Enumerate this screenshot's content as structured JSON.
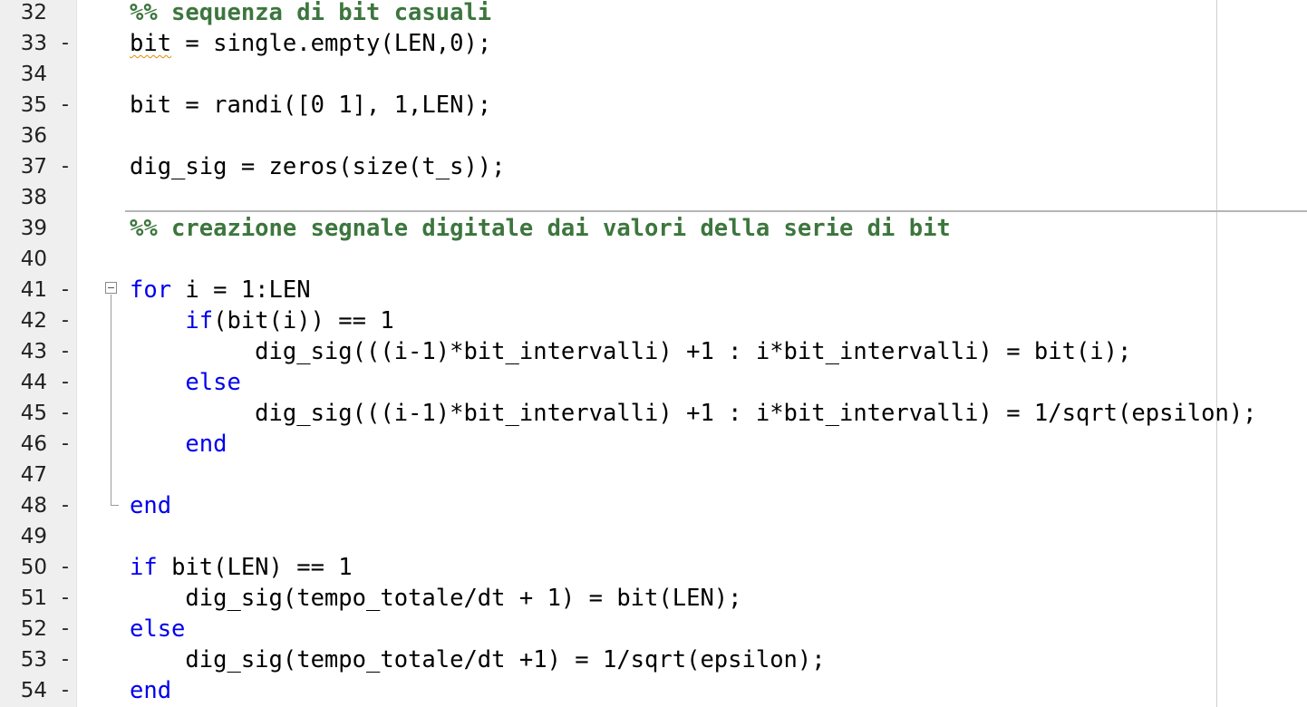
{
  "editor": {
    "lines": [
      {
        "number": "32",
        "marker": "",
        "tokens": [
          {
            "text": "%% sequenza di bit casuali",
            "type": "comment"
          }
        ]
      },
      {
        "number": "33",
        "marker": "-",
        "tokens": [
          {
            "text": "bit",
            "type": "plain",
            "squiggle": true
          },
          {
            "text": " = single.empty(LEN,0);",
            "type": "plain"
          }
        ]
      },
      {
        "number": "34",
        "marker": "",
        "tokens": []
      },
      {
        "number": "35",
        "marker": "-",
        "tokens": [
          {
            "text": "bit = randi([0 1], 1,LEN);",
            "type": "plain"
          }
        ]
      },
      {
        "number": "36",
        "marker": "",
        "tokens": []
      },
      {
        "number": "37",
        "marker": "-",
        "tokens": [
          {
            "text": "dig_sig = zeros(size(t_s));",
            "type": "plain"
          }
        ]
      },
      {
        "number": "38",
        "marker": "",
        "tokens": []
      },
      {
        "number": "39",
        "marker": "",
        "tokens": [
          {
            "text": "%% creazione segnale digitale dai valori della serie di bit",
            "type": "comment"
          }
        ]
      },
      {
        "number": "40",
        "marker": "",
        "tokens": []
      },
      {
        "number": "41",
        "marker": "-",
        "tokens": [
          {
            "text": "for",
            "type": "keyword"
          },
          {
            "text": " i = 1:LEN",
            "type": "plain"
          }
        ]
      },
      {
        "number": "42",
        "marker": "-",
        "tokens": [
          {
            "text": "    ",
            "type": "plain"
          },
          {
            "text": "if",
            "type": "keyword"
          },
          {
            "text": "(bit(i)) == 1",
            "type": "plain"
          }
        ]
      },
      {
        "number": "43",
        "marker": "-",
        "tokens": [
          {
            "text": "         dig_sig(((i-1)*bit_intervalli) +1 : i*bit_intervalli) = bit(i);",
            "type": "plain"
          }
        ]
      },
      {
        "number": "44",
        "marker": "-",
        "tokens": [
          {
            "text": "    ",
            "type": "plain"
          },
          {
            "text": "else",
            "type": "keyword"
          }
        ]
      },
      {
        "number": "45",
        "marker": "-",
        "tokens": [
          {
            "text": "         dig_sig(((i-1)*bit_intervalli) +1 : i*bit_intervalli) = 1/sqrt(epsilon);",
            "type": "plain"
          }
        ]
      },
      {
        "number": "46",
        "marker": "-",
        "tokens": [
          {
            "text": "    ",
            "type": "plain"
          },
          {
            "text": "end",
            "type": "keyword"
          }
        ]
      },
      {
        "number": "47",
        "marker": "",
        "tokens": []
      },
      {
        "number": "48",
        "marker": "-",
        "tokens": [
          {
            "text": "end",
            "type": "keyword"
          }
        ]
      },
      {
        "number": "49",
        "marker": "",
        "tokens": []
      },
      {
        "number": "50",
        "marker": "-",
        "tokens": [
          {
            "text": "if",
            "type": "keyword"
          },
          {
            "text": " bit(LEN) == 1",
            "type": "plain"
          }
        ]
      },
      {
        "number": "51",
        "marker": "-",
        "tokens": [
          {
            "text": "    dig_sig(tempo_totale/dt + 1) = bit(LEN);",
            "type": "plain"
          }
        ]
      },
      {
        "number": "52",
        "marker": "-",
        "tokens": [
          {
            "text": "else",
            "type": "keyword"
          }
        ]
      },
      {
        "number": "53",
        "marker": "-",
        "tokens": [
          {
            "text": "    dig_sig(tempo_totale/dt +1) = 1/sqrt(epsilon);",
            "type": "plain"
          }
        ]
      },
      {
        "number": "54",
        "marker": "-",
        "tokens": [
          {
            "text": "end",
            "type": "keyword"
          }
        ]
      }
    ]
  },
  "colors": {
    "comment": "#3c763d",
    "keyword": "#0000ee",
    "plain": "#000000",
    "gutter": "#efefef",
    "warning_squiggle": "#e08a00"
  },
  "icons": {
    "fold_toggle": "fold-minus-icon"
  }
}
